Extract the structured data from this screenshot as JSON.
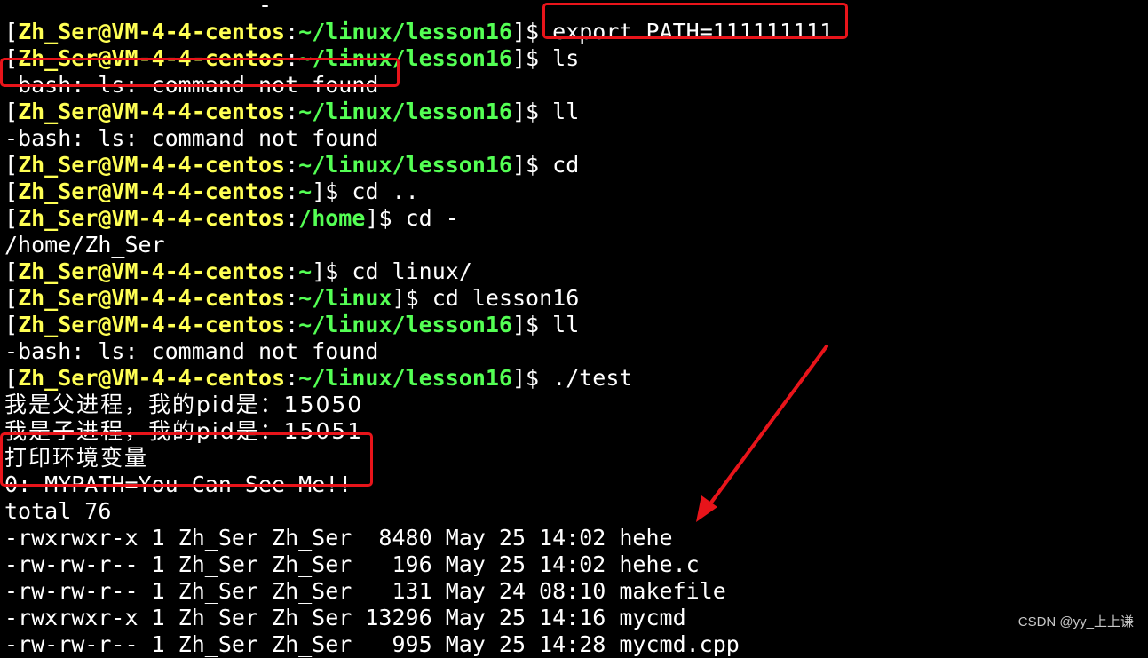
{
  "prompt": {
    "user_host": "Zh_Ser@VM-4-4-centos",
    "colon": ":",
    "dollar": "$ "
  },
  "lines": [
    {
      "type": "text",
      "text": "                   -      "
    },
    {
      "type": "prompt",
      "path": "~/linux/lesson16",
      "cmd": "export PATH=111111111"
    },
    {
      "type": "prompt",
      "path": "~/linux/lesson16",
      "cmd": "ls"
    },
    {
      "type": "text",
      "text": "-bash: ls: command not found"
    },
    {
      "type": "prompt",
      "path": "~/linux/lesson16",
      "cmd": "ll"
    },
    {
      "type": "text",
      "text": "-bash: ls: command not found"
    },
    {
      "type": "prompt",
      "path": "~/linux/lesson16",
      "cmd": "cd"
    },
    {
      "type": "prompt",
      "path": "~",
      "cmd": "cd .."
    },
    {
      "type": "prompt",
      "path": "/home",
      "cmd": "cd -"
    },
    {
      "type": "text",
      "text": "/home/Zh_Ser"
    },
    {
      "type": "prompt",
      "path": "~",
      "cmd": "cd linux/"
    },
    {
      "type": "prompt",
      "path": "~/linux",
      "cmd": "cd lesson16"
    },
    {
      "type": "prompt",
      "path": "~/linux/lesson16",
      "cmd": "ll"
    },
    {
      "type": "text",
      "text": "-bash: ls: command not found"
    },
    {
      "type": "prompt",
      "path": "~/linux/lesson16",
      "cmd": "./test"
    },
    {
      "type": "cjk",
      "text": "我是父进程，我的pid是：15050"
    },
    {
      "type": "cjk",
      "text": "我是子进程，我的pid是：15051"
    },
    {
      "type": "cjk",
      "text": "打印环境变量"
    },
    {
      "type": "text",
      "text": "0: MYPATH=You Can See Me!!"
    },
    {
      "type": "text",
      "text": "total 76"
    },
    {
      "type": "text",
      "text": "-rwxrwxr-x 1 Zh_Ser Zh_Ser  8480 May 25 14:02 hehe"
    },
    {
      "type": "text",
      "text": "-rw-rw-r-- 1 Zh_Ser Zh_Ser   196 May 25 14:02 hehe.c"
    },
    {
      "type": "text",
      "text": "-rw-rw-r-- 1 Zh_Ser Zh_Ser   131 May 24 08:10 makefile"
    },
    {
      "type": "text",
      "text": "-rwxrwxr-x 1 Zh_Ser Zh_Ser 13296 May 25 14:16 mycmd"
    },
    {
      "type": "text",
      "text": "-rw-rw-r-- 1 Zh_Ser Zh_Ser   995 May 25 14:28 mycmd.cpp"
    }
  ],
  "watermark": "CSDN @yy_上上谦",
  "colors": {
    "background": "#000000",
    "user_host": "#ffff54",
    "path": "#54ff54",
    "text": "#ffffff",
    "annotation": "#e8141a"
  }
}
